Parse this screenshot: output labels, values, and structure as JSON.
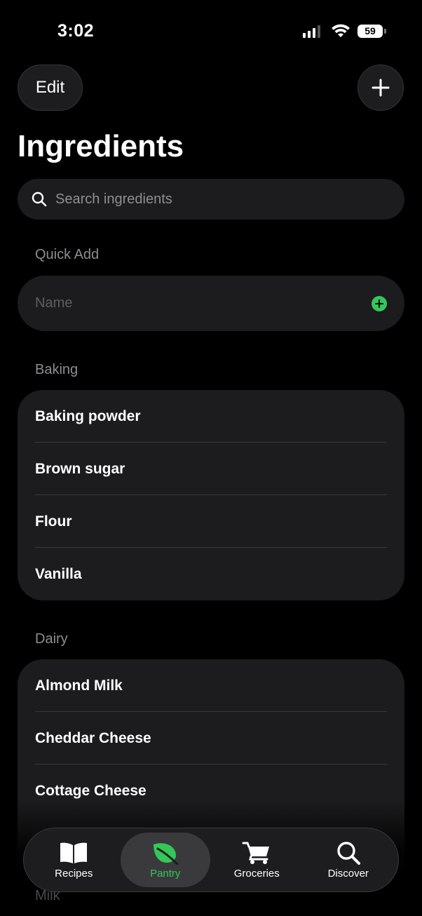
{
  "status_bar": {
    "time": "3:02",
    "battery": "59"
  },
  "header": {
    "edit_label": "Edit",
    "title": "Ingredients"
  },
  "search": {
    "placeholder": "Search ingredients"
  },
  "quick_add": {
    "header": "Quick Add",
    "placeholder": "Name"
  },
  "groups": [
    {
      "header": "Baking",
      "items": [
        "Baking powder",
        "Brown sugar",
        "Flour",
        "Vanilla"
      ]
    },
    {
      "header": "Dairy",
      "items": [
        "Almond Milk",
        "Cheddar Cheese",
        "Cottage Cheese"
      ]
    }
  ],
  "next_group_header": "Milk",
  "tab_bar": {
    "tabs": [
      {
        "label": "Recipes",
        "icon": "book-icon"
      },
      {
        "label": "Pantry",
        "icon": "leaf-icon",
        "active": true
      },
      {
        "label": "Groceries",
        "icon": "cart-icon"
      },
      {
        "label": "Discover",
        "icon": "magnifier-icon"
      }
    ]
  },
  "colors": {
    "accent": "#34c759",
    "background": "#000000",
    "card": "#1c1c1e"
  }
}
